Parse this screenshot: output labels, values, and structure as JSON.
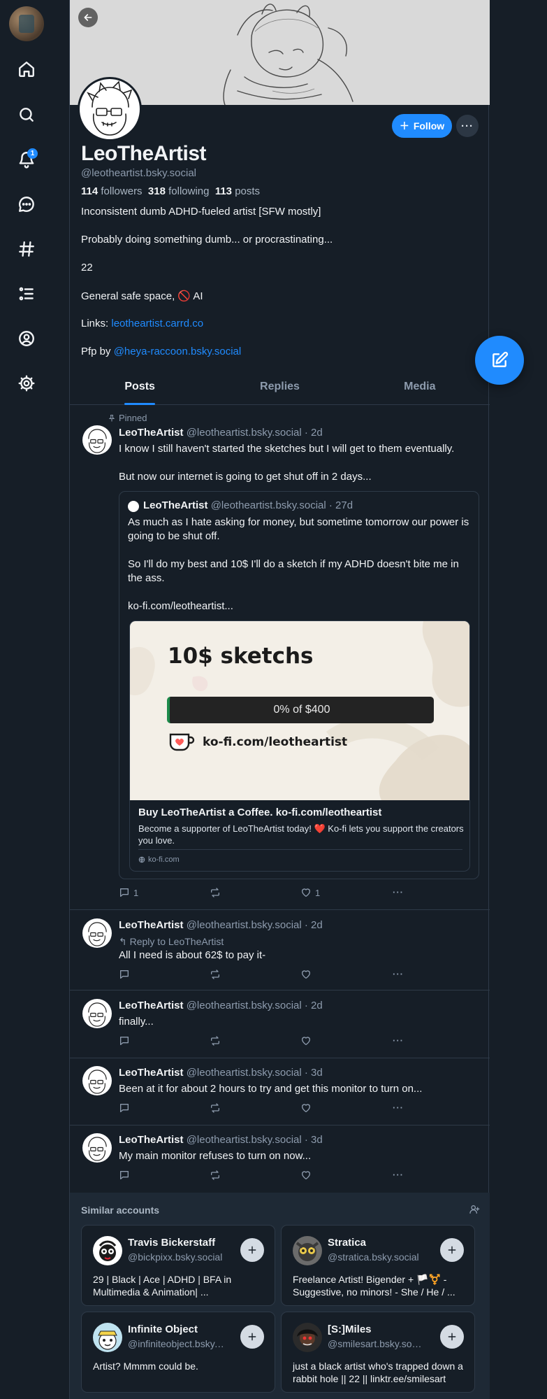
{
  "profile": {
    "display_name": "LeoTheArtist",
    "handle": "@leotheartist.bsky.social",
    "followers_count": "114",
    "followers_label": "followers",
    "following_count": "318",
    "following_label": "following",
    "posts_count": "113",
    "posts_label": "posts",
    "bio": {
      "line1": "Inconsistent dumb ADHD-fueled artist [SFW mostly]",
      "line2": "Probably doing something dumb... or procrastinating...",
      "line3": "22",
      "line4": "General safe space, 🚫 AI",
      "links_label": "Links: ",
      "links_url": "leotheartist.carrd.co",
      "pfp_label": "Pfp by ",
      "pfp_handle": "@heya-raccoon.bsky.social"
    },
    "follow_label": "Follow"
  },
  "notifications_badge": "1",
  "tabs": [
    {
      "label": "Posts"
    },
    {
      "label": "Replies"
    },
    {
      "label": "Media"
    }
  ],
  "pinned_label": "Pinned",
  "posts": [
    {
      "name": "LeoTheArtist",
      "meta": "@leotheartist.bsky.social · 2d",
      "text1": "I know I still haven't started the sketches but I will get to them eventually.",
      "text2": "But now our internet is going to get shut off in 2 days...",
      "replies": "1",
      "likes": "1",
      "quote": {
        "name": "LeoTheArtist",
        "meta": "@leotheartist.bsky.social · 27d",
        "text1": "As much as I hate asking for money, but sometime tomorrow our power is going to be shut off.",
        "text2": "So I'll do my best and 10$ I'll do a sketch if my ADHD doesn't bite me in the ass.",
        "text3": "ko-fi.com/leotheartist...",
        "embed": {
          "image_title": "10$ sketchs",
          "progress_text": "0% of $400",
          "progress_fraction": 0,
          "image_url": "ko-fi.com/leotheartist",
          "card_title": "Buy LeoTheArtist a Coffee. ko-fi.com/leotheartist",
          "card_desc": "Become a supporter of LeoTheArtist today! ❤️ Ko-fi lets you support the creators you love.",
          "card_domain": "ko-fi.com"
        }
      }
    },
    {
      "name": "LeoTheArtist",
      "meta": "@leotheartist.bsky.social · 2d",
      "reply_to": "Reply to LeoTheArtist",
      "text": "All I need is about 62$ to pay it-"
    },
    {
      "name": "LeoTheArtist",
      "meta": "@leotheartist.bsky.social · 2d",
      "text": "finally..."
    },
    {
      "name": "LeoTheArtist",
      "meta": "@leotheartist.bsky.social · 3d",
      "text": "Been at it for about 2 hours to try and get this monitor to turn on..."
    },
    {
      "name": "LeoTheArtist",
      "meta": "@leotheartist.bsky.social · 3d",
      "text": "My main monitor refuses to turn on now..."
    }
  ],
  "similar": {
    "title": "Similar accounts",
    "accounts": [
      {
        "name": "Travis Bickerstaff",
        "handle": "@bickpixx.bsky.social",
        "desc": "29 | Black | Ace | ADHD | BFA in Multimedia & Animation| ..."
      },
      {
        "name": "Stratica",
        "handle": "@stratica.bsky.social",
        "desc": "Freelance Artist! Bigender + 🏳️⚧️ - Suggestive, no minors! - She / He / ..."
      },
      {
        "name": "Infinite Object",
        "handle": "@infiniteobject.bsky.s...",
        "desc": "Artist? Mmmm could be."
      },
      {
        "name": "[S:]Miles",
        "handle": "@smilesart.bsky.social",
        "desc": "just a black artist who's trapped down a rabbit hole || 22 || linktr.ee/smilesart"
      }
    ]
  },
  "colors": {
    "background": "#161e27",
    "accent": "#208bfe",
    "muted_text": "#8d9bad"
  }
}
